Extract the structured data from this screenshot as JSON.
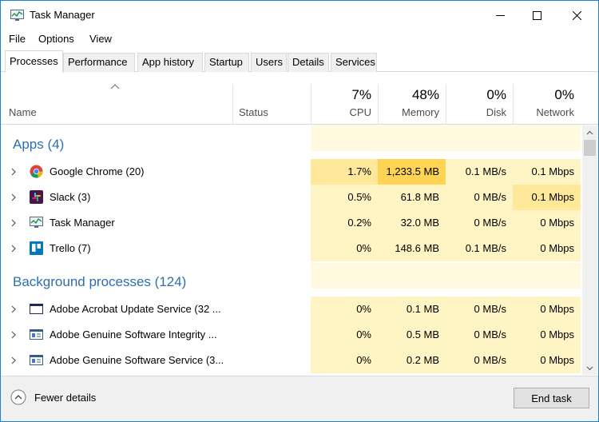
{
  "window": {
    "title": "Task Manager"
  },
  "menu": [
    "File",
    "Options",
    "View"
  ],
  "tabs": [
    "Processes",
    "Performance",
    "App history",
    "Startup",
    "Users",
    "Details",
    "Services"
  ],
  "columns": {
    "name": "Name",
    "status": "Status",
    "cpu": {
      "percent": "7%",
      "label": "CPU"
    },
    "memory": {
      "percent": "48%",
      "label": "Memory"
    },
    "disk": {
      "percent": "0%",
      "label": "Disk"
    },
    "network": {
      "percent": "0%",
      "label": "Network"
    }
  },
  "groups": {
    "apps": "Apps (4)",
    "background": "Background processes (124)"
  },
  "rows": [
    {
      "name": "Google Chrome (20)",
      "icon": "chrome-icon",
      "cpu": "1.7%",
      "memory": "1,233.5 MB",
      "disk": "0.1 MB/s",
      "network": "0.1 Mbps"
    },
    {
      "name": "Slack (3)",
      "icon": "slack-icon",
      "cpu": "0.5%",
      "memory": "61.8 MB",
      "disk": "0 MB/s",
      "network": "0.1 Mbps"
    },
    {
      "name": "Task Manager",
      "icon": "task-manager-icon",
      "cpu": "0.2%",
      "memory": "32.0 MB",
      "disk": "0 MB/s",
      "network": "0 Mbps"
    },
    {
      "name": "Trello (7)",
      "icon": "trello-icon",
      "cpu": "0%",
      "memory": "148.6 MB",
      "disk": "0.1 MB/s",
      "network": "0 Mbps"
    },
    {
      "name": "Adobe Acrobat Update Service (32 ...",
      "icon": "window-icon",
      "cpu": "0%",
      "memory": "0.1 MB",
      "disk": "0 MB/s",
      "network": "0 Mbps"
    },
    {
      "name": "Adobe Genuine Software Integrity ...",
      "icon": "service-window-icon",
      "cpu": "0%",
      "memory": "0.5 MB",
      "disk": "0 MB/s",
      "network": "0 Mbps"
    },
    {
      "name": "Adobe Genuine Software Service (3...",
      "icon": "service-window-icon",
      "cpu": "0%",
      "memory": "0.2 MB",
      "disk": "0 MB/s",
      "network": "0 Mbps"
    }
  ],
  "footer": {
    "fewer_details": "Fewer details",
    "end_task": "End task"
  },
  "colors": {
    "accent": "#1883d7",
    "group": "#2c6fb0",
    "heat_low": "#fff4c4",
    "heat_mid": "#ffe89a",
    "heat_high": "#ffd455"
  }
}
